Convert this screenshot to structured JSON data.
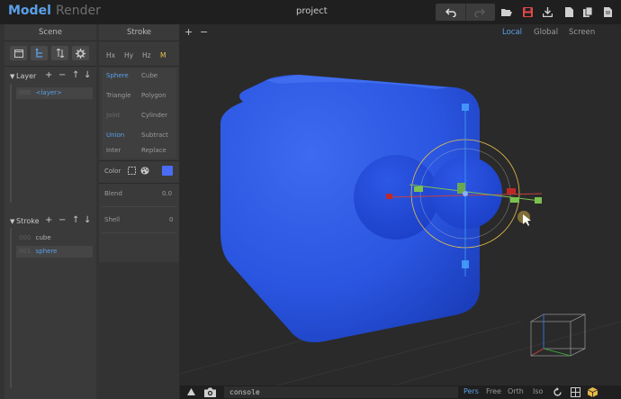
{
  "topbar": {
    "model_tab": "Model",
    "render_tab": "Render",
    "project_name": "project"
  },
  "scene_panel": {
    "title": "Scene",
    "layer_section": {
      "title": "Layer",
      "items": [
        {
          "num": "000",
          "label": "<layer>"
        }
      ]
    },
    "stroke_section": {
      "title": "Stroke",
      "items": [
        {
          "num": "000",
          "label": "cube"
        },
        {
          "num": "001",
          "label": "sphere"
        }
      ]
    },
    "section_buttons": [
      "+",
      "−",
      "↑",
      "↓"
    ]
  },
  "stroke_panel": {
    "title": "Stroke",
    "mirror_tabs": [
      "Hx",
      "Hy",
      "Hz",
      "M"
    ],
    "shapes": [
      "Sphere",
      "Cube",
      "Triangle",
      "Polygon",
      "Joint",
      "Cylinder"
    ],
    "ops": [
      "Union",
      "Subtract",
      "Inter",
      "Replace"
    ],
    "color_label": "Color",
    "color_value": "#4a6cf5",
    "blend_label": "Blend",
    "blend_value": "0.0",
    "shell_label": "Shell",
    "shell_value": "0"
  },
  "viewport": {
    "zoom_in": "+",
    "zoom_out": "−",
    "spaces": [
      "Local",
      "Global",
      "Screen"
    ],
    "object_color": "#2f5ae0"
  },
  "bottombar": {
    "console_text": "console",
    "projections": [
      "Pers",
      "Free",
      "Orth",
      "Iso"
    ]
  }
}
